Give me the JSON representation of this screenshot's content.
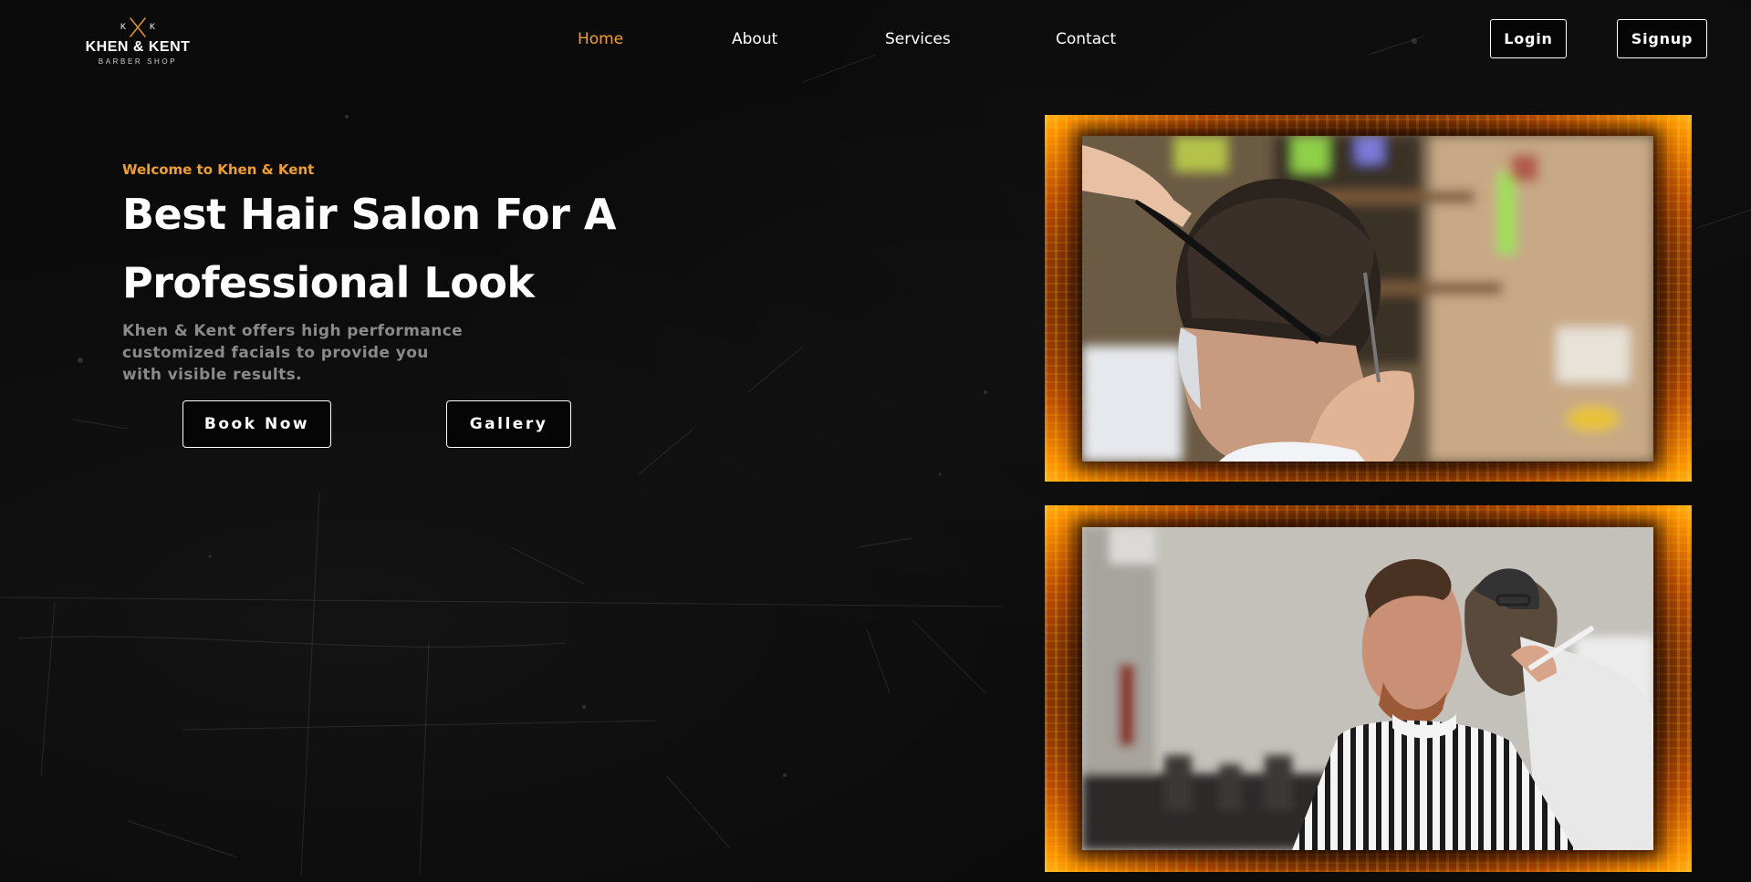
{
  "brand": {
    "initials_left": "K",
    "initials_right": "K",
    "name": "KHEN & KENT",
    "tagline": "BARBER SHOP",
    "icon": "crossed-scissors-icon"
  },
  "nav": {
    "links": [
      {
        "label": "Home",
        "active": true
      },
      {
        "label": "About",
        "active": false
      },
      {
        "label": "Services",
        "active": false
      },
      {
        "label": "Contact",
        "active": false
      }
    ],
    "login_label": "Login",
    "signup_label": "Signup"
  },
  "hero": {
    "eyebrow": "Welcome to Khen & Kent",
    "headline_line1": "Best Hair Salon For A",
    "headline_line2": "Professional Look",
    "description_line1": "Khen & Kent offers high performance",
    "description_line2": "customized facials to provide you",
    "description_line3": "with visible results.",
    "book_label": "Book Now",
    "gallery_label": "Gallery"
  },
  "colors": {
    "accent": "#f0a02a",
    "background": "#0b0b0b",
    "frame_glow": "#ff9200",
    "muted_text": "#8a8a8a"
  }
}
